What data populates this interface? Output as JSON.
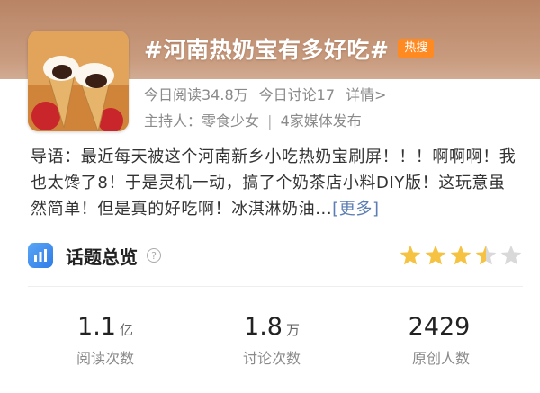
{
  "topic": {
    "title": "#河南热奶宝有多好吃#",
    "badge": "热搜"
  },
  "stats_line": {
    "reads": "今日阅读34.8万",
    "discussions": "今日讨论17",
    "details": "详情>"
  },
  "host": {
    "label": "主持人：零食少女",
    "separator": "|",
    "media": "4家媒体发布"
  },
  "intro": {
    "text": "导语：最近每天被这个河南新乡小吃热奶宝刷屏！！！啊啊啊！我也太馋了8！于是灵机一动，搞了个奶茶店小料DIY版！这玩意虽然简单！但是真的好吃啊！冰淇淋奶油...",
    "more": "[更多]"
  },
  "overview": {
    "title": "话题总览",
    "help": "?",
    "rating": 3.5,
    "max_rating": 5
  },
  "metrics": [
    {
      "value": "1.1",
      "unit": "亿",
      "label": "阅读次数"
    },
    {
      "value": "1.8",
      "unit": "万",
      "label": "讨论次数"
    },
    {
      "value": "2429",
      "unit": "",
      "label": "原创人数"
    }
  ],
  "colors": {
    "hot_badge": "#ff8a22",
    "star_filled": "#f5c242",
    "star_empty": "#d9d9d9",
    "link": "#5b7db3"
  }
}
